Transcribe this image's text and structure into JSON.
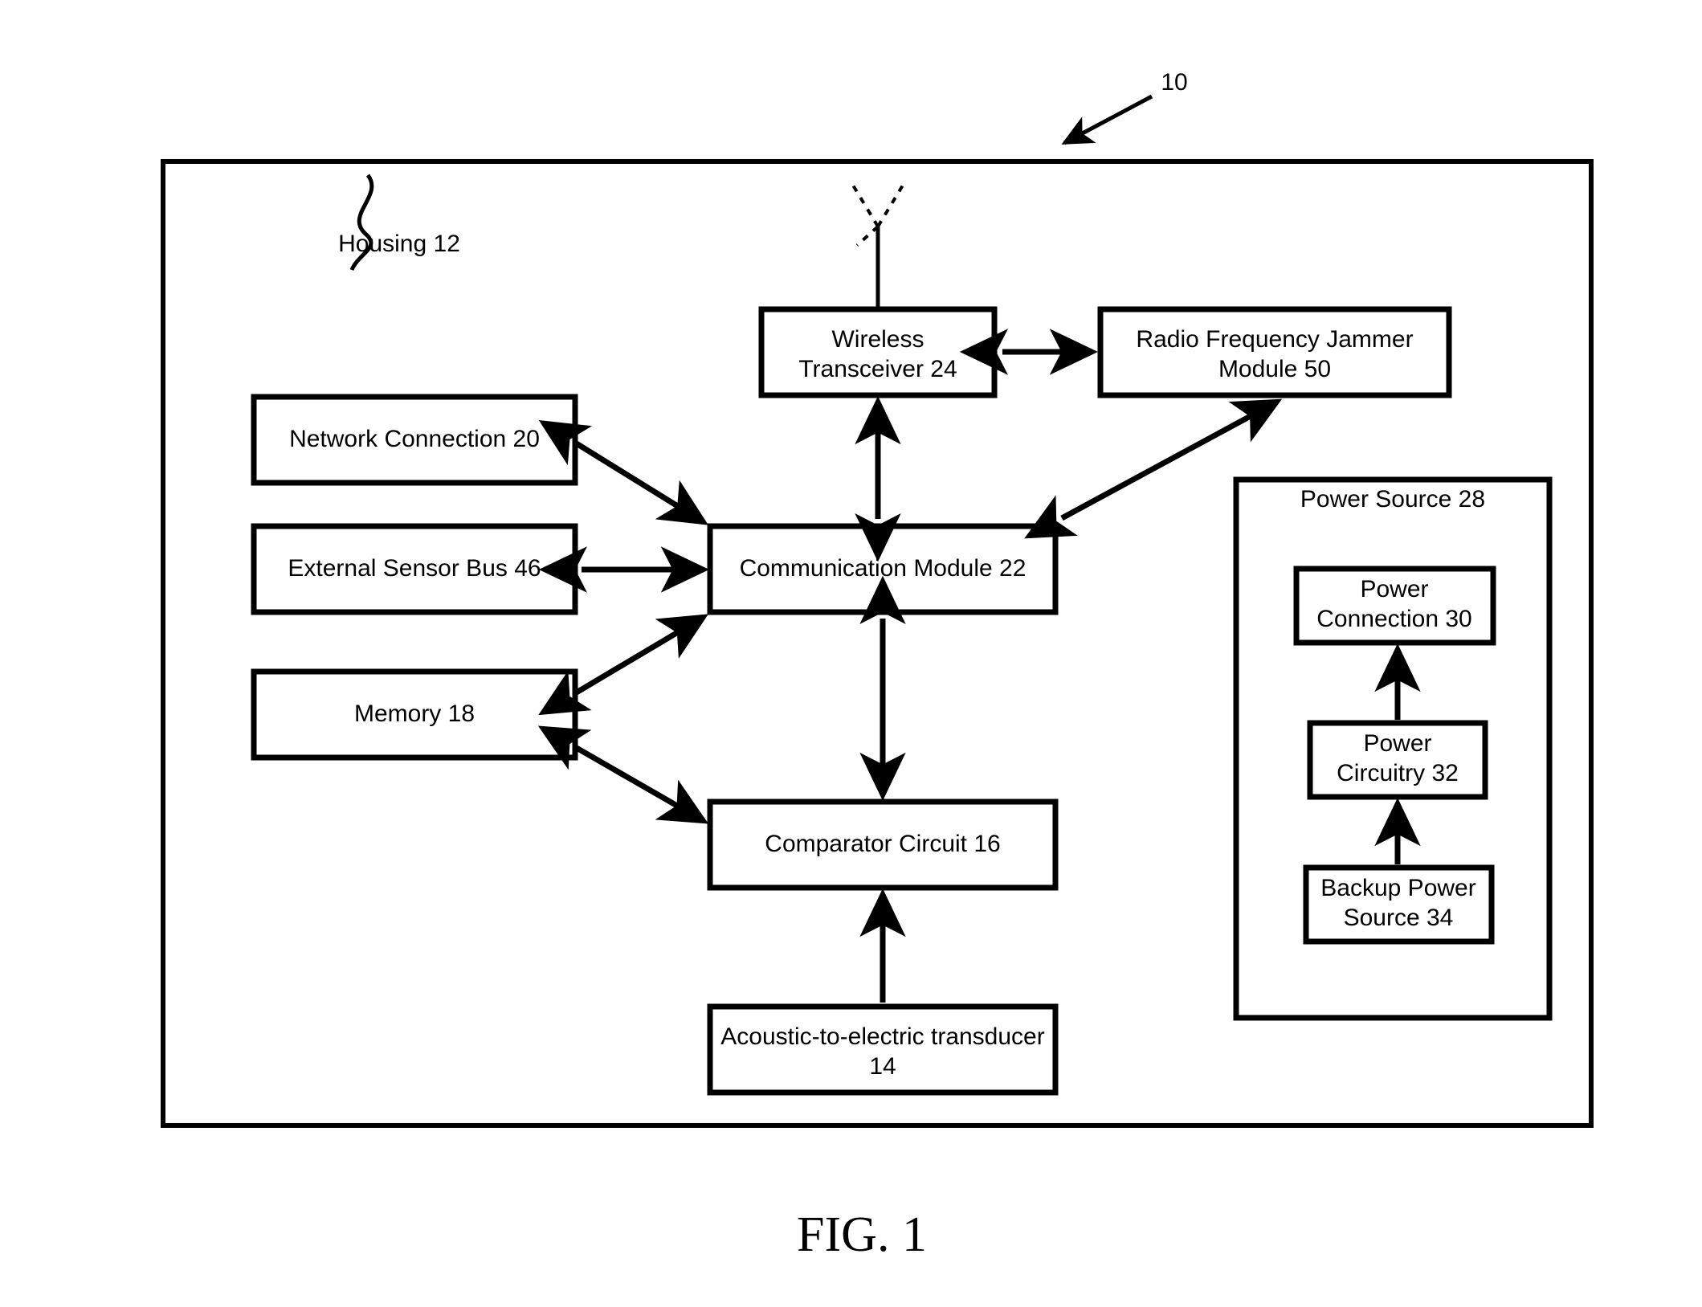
{
  "figure": {
    "caption": "FIG. 1",
    "system_reference": "10",
    "housing_label": "Housing 12"
  },
  "blocks": {
    "wireless_transceiver": {
      "line1": "Wireless",
      "line2": "Transceiver 24"
    },
    "rf_jammer": {
      "line1": "Radio Frequency Jammer",
      "line2": "Module 50"
    },
    "network_connection": {
      "line1": "Network Connection 20"
    },
    "external_sensor_bus": {
      "line1": "External Sensor Bus 46"
    },
    "memory": {
      "line1": "Memory 18"
    },
    "communication_module": {
      "line1": "Communication Module 22"
    },
    "comparator_circuit": {
      "line1": "Comparator Circuit 16"
    },
    "transducer": {
      "line1": "Acoustic-to-electric transducer",
      "line2": "14"
    },
    "power_source": {
      "line1": "Power Source 28"
    },
    "power_connection": {
      "line1": "Power",
      "line2": "Connection 30"
    },
    "power_circuitry": {
      "line1": "Power",
      "line2": "Circuitry 32"
    },
    "backup_power_source": {
      "line1": "Backup Power",
      "line2": "Source 34"
    }
  },
  "icons": {
    "antenna": "antenna-icon",
    "system_arrow": "reference-arrow-icon",
    "housing_leader": "leader-squiggle-icon"
  },
  "colors": {
    "stroke": "#000000",
    "background": "#ffffff"
  }
}
